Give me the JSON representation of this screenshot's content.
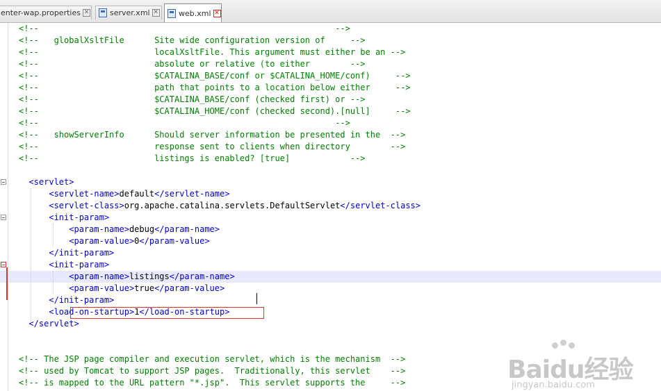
{
  "tabs": [
    {
      "label": "enter-wap.properties",
      "active": false
    },
    {
      "label": "server.xml",
      "active": false
    },
    {
      "label": "web.xml",
      "active": true
    }
  ],
  "editor_lines": [
    "<!--                                                           -->",
    "<!--   globalXsltFile      Site wide configuration version of     -->",
    "<!--                       localXsltFile. This argument must either be an -->",
    "<!--                       absolute or relative (to either        -->",
    "<!--                       $CATALINA_BASE/conf or $CATALINA_HOME/conf)     -->",
    "<!--                       path that points to a location below either     -->",
    "<!--                       $CATALINA_BASE/conf (checked first) or -->",
    "<!--                       $CATALINA_HOME/conf (checked second).[null]     -->",
    "<!--                                                           -->",
    "<!--   showServerInfo      Should server information be presented in the  -->",
    "<!--                       response sent to clients when directory        -->",
    "<!--                       listings is enabled? [true]            -->",
    "",
    "  <servlet>",
    "      <servlet-name>default</servlet-name>",
    "      <servlet-class>org.apache.catalina.servlets.DefaultServlet</servlet-class>",
    "      <init-param>",
    "          <param-name>debug</param-name>",
    "          <param-value>0</param-value>",
    "      </init-param>",
    "      <init-param>",
    "          <param-name>listings</param-name>",
    "          <param-value>true</param-value>",
    "      </init-param>",
    "      <load-on-startup>1</load-on-startup>",
    "  </servlet>",
    "",
    "",
    "<!-- The JSP page compiler and execution servlet, which is the mechanism  -->",
    "<!-- used by Tomcat to support JSP pages.  Traditionally, this servlet    -->",
    "<!-- is mapped to the URL pattern \"*.jsp\".  This servlet supports the     -->"
  ],
  "watermark": {
    "brand": "Baidu经验",
    "url": "jingyan.baidu.com"
  },
  "colors": {
    "comment": "#008000",
    "tag": "#0000d0",
    "text": "#000000",
    "highlight_box": "#e03030"
  }
}
